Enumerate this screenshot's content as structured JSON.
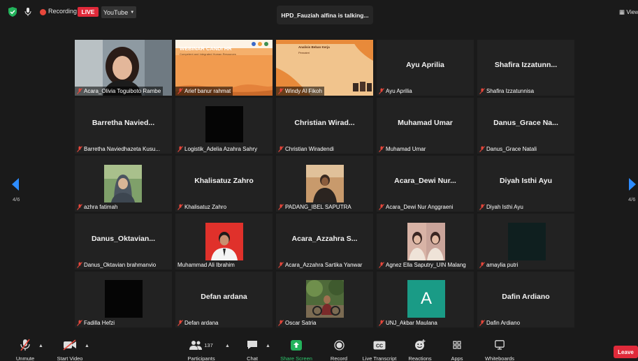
{
  "topbar": {
    "recording": "Recording",
    "live": "LIVE",
    "youtube": "YouTube",
    "talking": "HPD_Fauziah alfina is talking...",
    "view": "View"
  },
  "nav": {
    "page_left": "4/6",
    "page_right": "4/6"
  },
  "tiles": [
    {
      "label": "Acara_Olivia Toguiboto Rambe",
      "name": ""
    },
    {
      "label": "Arief banur rahmat",
      "name": ""
    },
    {
      "label": "Windy Al Fikoh",
      "name": ""
    },
    {
      "label": "Ayu Aprilia",
      "name": "Ayu Aprilia"
    },
    {
      "label": "Shafira Izzatunnisa",
      "name": "Shafira  Izzatunn..."
    },
    {
      "label": "Barretha Naviedhazeta Kusu...",
      "name": "Barretha  Navied..."
    },
    {
      "label": "Logistik_Adelia Azahra Sahry",
      "name": ""
    },
    {
      "label": "Christian Wiradendi",
      "name": "Christian  Wirad..."
    },
    {
      "label": "Muhamad Umar",
      "name": "Muhamad Umar"
    },
    {
      "label": "Danus_Grace Natali",
      "name": "Danus_Grace  Na..."
    },
    {
      "label": "azhra fatimah",
      "name": ""
    },
    {
      "label": "Khalisatuz Zahro",
      "name": "Khalisatuz Zahro"
    },
    {
      "label": "PADANG_IBEL SAPUTRA",
      "name": ""
    },
    {
      "label": "Acara_Dewi Nur Anggraeni",
      "name": "Acara_Dewi  Nur..."
    },
    {
      "label": "Diyah Isthi Ayu",
      "name": "Diyah Isthi Ayu"
    },
    {
      "label": "Danus_Oktavian brahmanvio",
      "name": "Danus_Oktavian..."
    },
    {
      "label": "Muhammad Ali Ibrahim",
      "name": ""
    },
    {
      "label": "Acara_Azzahra Sartika Yanwar",
      "name": "Acara_Azzahra  S..."
    },
    {
      "label": "Agnez Ella Saputry_UIN Malang",
      "name": ""
    },
    {
      "label": "amaylia putri",
      "name": ""
    },
    {
      "label": "Fadilla Hefzi",
      "name": ""
    },
    {
      "label": "Defan ardana",
      "name": "Defan ardana"
    },
    {
      "label": "Oscar Satria",
      "name": ""
    },
    {
      "label": "UNJ_Akbar Maulana",
      "name": ""
    },
    {
      "label": "Dafin Ardiano",
      "name": "Dafin Ardiano"
    }
  ],
  "slides": {
    "webinar_title": "WEBINAR CANDI HR",
    "webinar_sub": "Competent and Integrated Human Resources",
    "windy_title": "Analisis Beban Kerja",
    "windy_sub": "Pemateri",
    "avatar_letter": "A"
  },
  "toolbar": {
    "unmute": "Unmute",
    "start_video": "Start Video",
    "participants_count": "137",
    "participants": "Participants",
    "chat": "Chat",
    "share_screen": "Share Screen",
    "record": "Record",
    "live_transcript": "Live Transcript",
    "reactions": "Reactions",
    "apps": "Apps",
    "whiteboards": "Whiteboards",
    "leave": "Leave"
  },
  "colors": {
    "accent_green": "#2dc86c",
    "live_red": "#e02a3a",
    "nav_blue": "#2d8cff",
    "mute_red": "#e8473b"
  }
}
